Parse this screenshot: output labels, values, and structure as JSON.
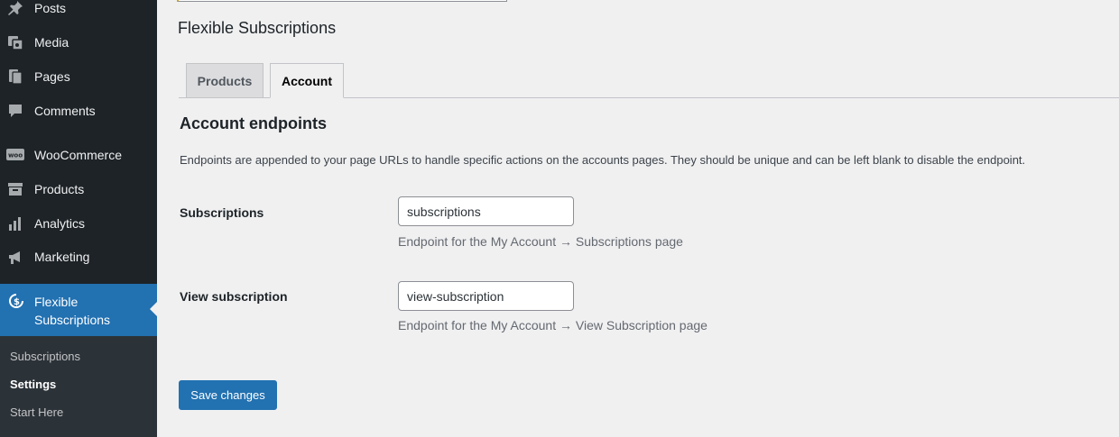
{
  "sidebar": {
    "items": [
      {
        "label": "Posts",
        "icon": "pin-icon"
      },
      {
        "label": "Media",
        "icon": "media-icon"
      },
      {
        "label": "Pages",
        "icon": "pages-icon"
      },
      {
        "label": "Comments",
        "icon": "comments-icon"
      },
      {
        "label": "WooCommerce",
        "icon": "woocommerce-icon"
      },
      {
        "label": "Products",
        "icon": "archive-icon"
      },
      {
        "label": "Analytics",
        "icon": "bar-chart-icon"
      },
      {
        "label": "Marketing",
        "icon": "megaphone-icon"
      }
    ],
    "active": {
      "label": "Flexible Subscriptions",
      "icon": "subscriptions-icon"
    },
    "submenu": [
      {
        "label": "Subscriptions"
      },
      {
        "label": "Settings"
      },
      {
        "label": "Start Here"
      }
    ],
    "woo_badge": "woo"
  },
  "page": {
    "title": "Flexible Subscriptions",
    "tabs": [
      {
        "label": "Products"
      },
      {
        "label": "Account"
      }
    ],
    "section_title": "Account endpoints",
    "section_desc": "Endpoints are appended to your page URLs to handle specific actions on the accounts pages. They should be unique and can be left blank to disable the endpoint.",
    "fields": [
      {
        "label": "Subscriptions",
        "value": "subscriptions",
        "help": "Endpoint for the My Account → Subscriptions page"
      },
      {
        "label": "View subscription",
        "value": "view-subscription",
        "help": "Endpoint for the My Account → View Subscription page"
      }
    ],
    "save_label": "Save changes"
  },
  "colors": {
    "sidebar_bg": "#1d2327",
    "accent": "#2271b1",
    "page_bg": "#f0f0f1"
  }
}
